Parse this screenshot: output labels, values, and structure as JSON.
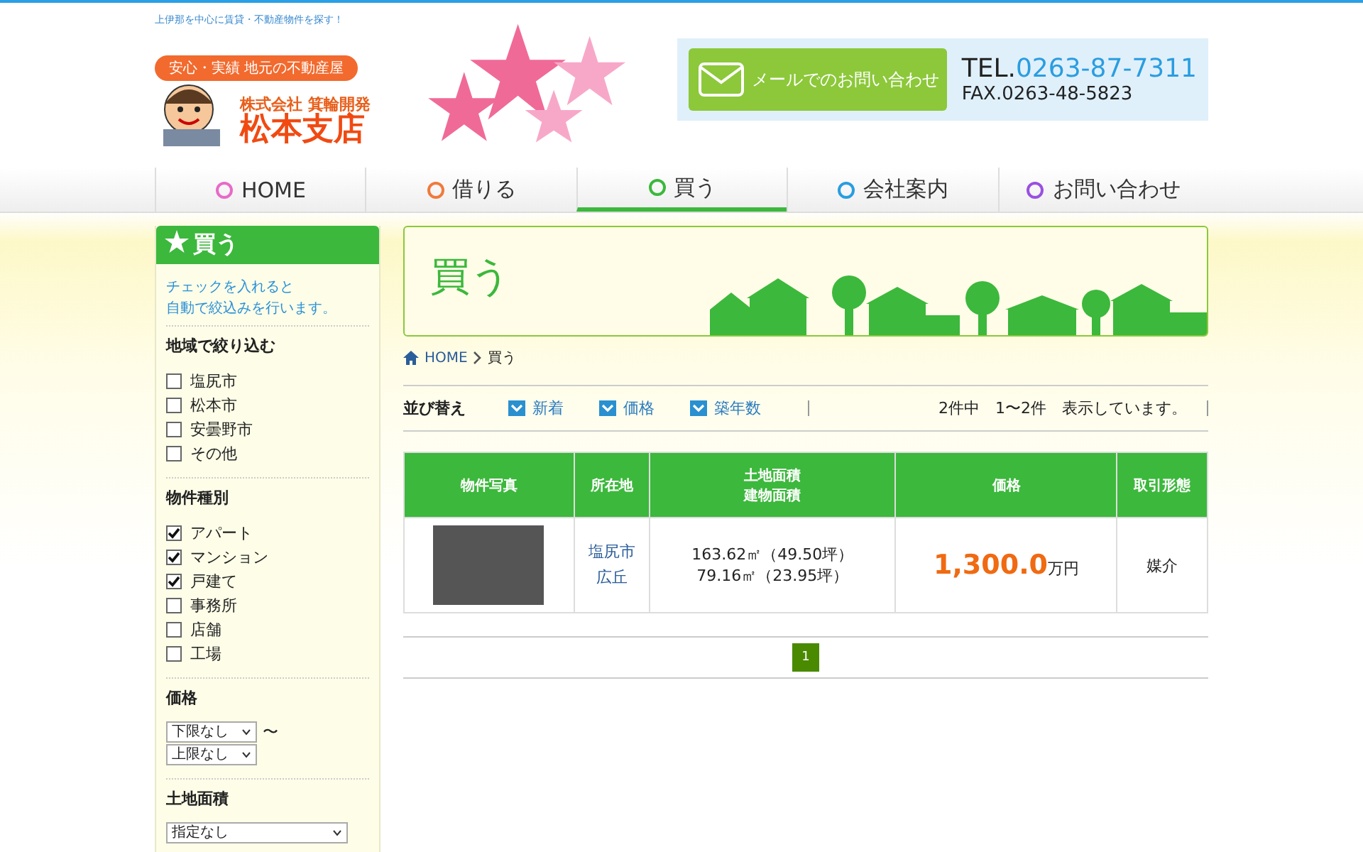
{
  "header": {
    "tagline": "上伊那を中心に賃貸・不動産物件を探す！",
    "slogan": "安心・実績 地元の不動産屋",
    "company": "株式会社 箕輪開発",
    "branch": "松本支店",
    "mail_button": "メールでのお問い合わせ",
    "tel_label": "TEL.",
    "tel": "0263-87-7311",
    "fax": "FAX.0263-48-5823"
  },
  "nav": [
    {
      "label": "HOME",
      "color": "#e86ac8",
      "selected": false
    },
    {
      "label": "借りる",
      "color": "#f07a3c",
      "selected": false
    },
    {
      "label": "買う",
      "color": "#3cb83c",
      "selected": true
    },
    {
      "label": "会社案内",
      "color": "#2a9de0",
      "selected": false
    },
    {
      "label": "お問い合わせ",
      "color": "#9a50e0",
      "selected": false
    }
  ],
  "sidebar": {
    "title": "買う",
    "note": [
      "チェックを入れると",
      "自動で絞込みを行います。"
    ],
    "sections": [
      {
        "kind": "checks",
        "title": "地域で絞り込む",
        "items": [
          {
            "label": "塩尻市",
            "checked": false
          },
          {
            "label": "松本市",
            "checked": false
          },
          {
            "label": "安曇野市",
            "checked": false
          },
          {
            "label": "その他",
            "checked": false
          }
        ]
      },
      {
        "kind": "checks",
        "title": "物件種別",
        "items": [
          {
            "label": "アパート",
            "checked": true
          },
          {
            "label": "マンション",
            "checked": true
          },
          {
            "label": "戸建て",
            "checked": true
          },
          {
            "label": "事務所",
            "checked": false
          },
          {
            "label": "店舗",
            "checked": false
          },
          {
            "label": "工場",
            "checked": false
          }
        ]
      },
      {
        "kind": "range",
        "title": "価格",
        "from": "下限なし",
        "separator": "〜",
        "to": "上限なし"
      },
      {
        "kind": "select",
        "title": "土地面積",
        "value": "指定なし"
      }
    ]
  },
  "banner": {
    "title": "買う"
  },
  "breadcrumb": {
    "home": "HOME",
    "current": "買う"
  },
  "sort": {
    "label": "並び替え",
    "options": [
      "新着",
      "価格",
      "築年数"
    ],
    "count": "2件中　1〜2件　表示しています。"
  },
  "table": {
    "columns": [
      [
        "物件写真"
      ],
      [
        "所在地"
      ],
      [
        "土地面積",
        "建物面積"
      ],
      [
        "価格"
      ],
      [
        "取引形態"
      ]
    ],
    "rows": [
      {
        "city": "塩尻市",
        "area": "広丘",
        "land": "163.62㎡（49.50坪）",
        "building": "79.16㎡（23.95坪）",
        "price": "1,300.0",
        "unit": "万円",
        "deal": "媒介"
      }
    ]
  },
  "pagination": [
    {
      "label": "1",
      "selected": true
    }
  ]
}
